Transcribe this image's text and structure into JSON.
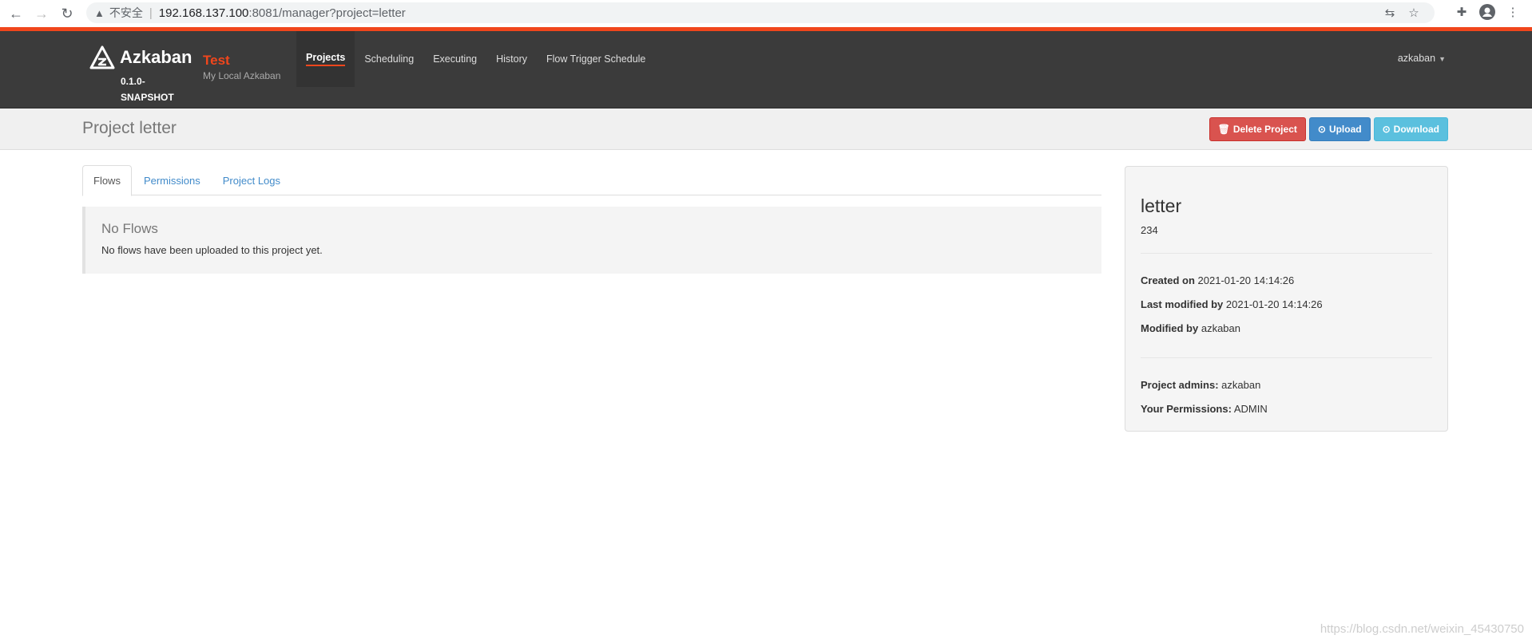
{
  "browser": {
    "insecure_label": "不安全",
    "url_host": "192.168.137.100",
    "url_path": ":8081/manager?project=letter"
  },
  "navbar": {
    "brand_name": "Azkaban",
    "version": "0.1.0-SNAPSHOT",
    "env_name": "Test",
    "env_desc": "My Local Azkaban",
    "items": [
      {
        "label": "Projects",
        "active": true
      },
      {
        "label": "Scheduling"
      },
      {
        "label": "Executing"
      },
      {
        "label": "History"
      },
      {
        "label": "Flow Trigger Schedule"
      }
    ],
    "user": "azkaban"
  },
  "header": {
    "title": "Project letter",
    "delete_label": "Delete Project",
    "upload_label": "Upload",
    "download_label": "Download"
  },
  "tabs": [
    {
      "label": "Flows",
      "active": true
    },
    {
      "label": "Permissions"
    },
    {
      "label": "Project Logs"
    }
  ],
  "callout": {
    "title": "No Flows",
    "text": "No flows have been uploaded to this project yet."
  },
  "panel": {
    "name": "letter",
    "description": "234",
    "created_label": "Created on",
    "created_value": "2021-01-20 14:14:26",
    "modified_label": "Last modified by",
    "modified_value": "2021-01-20 14:14:26",
    "modified_by_label": "Modified by",
    "modified_by_value": "azkaban",
    "admins_label": "Project admins:",
    "admins_value": "azkaban",
    "permissions_label": "Your Permissions:",
    "permissions_value": "ADMIN"
  },
  "watermark": "https://blog.csdn.net/weixin_45430750",
  "colors": {
    "accent": "#f0461c",
    "navbar": "#3b3b3b",
    "danger": "#d9534f",
    "primary": "#428bca",
    "info": "#5bc0de"
  }
}
